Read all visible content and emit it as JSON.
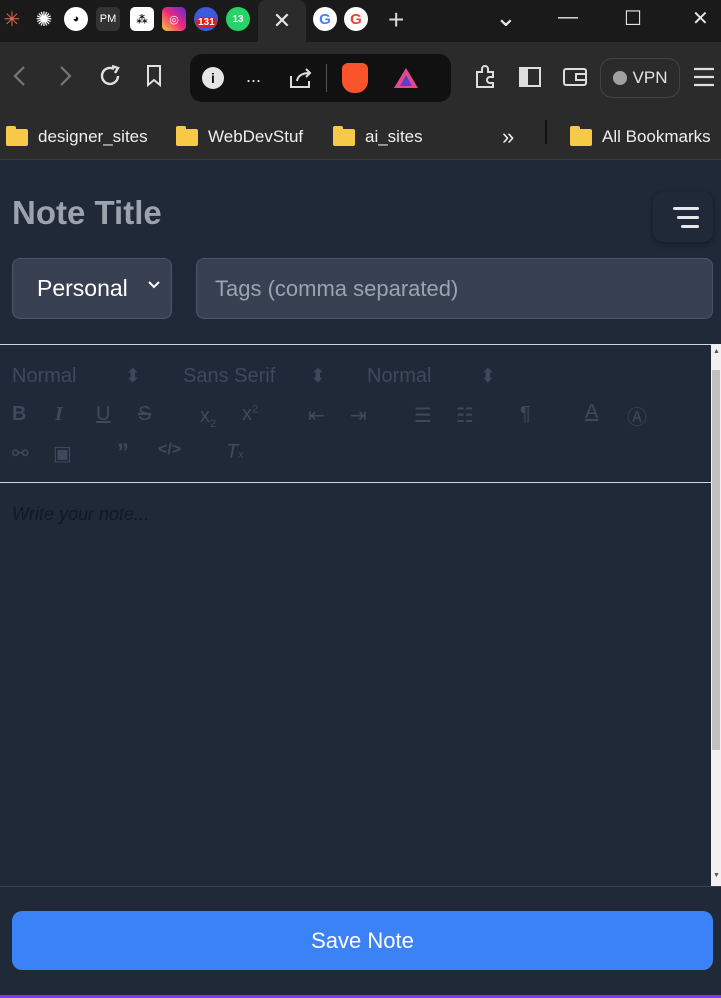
{
  "browser": {
    "tabs": {
      "pm_label": "PM",
      "badge_131": "131",
      "badge_13": "13",
      "google_1": "G",
      "google_2": "G",
      "active_close": "✕",
      "new_tab": "+"
    },
    "window": {
      "chevron": "⌄",
      "minimize": "—",
      "maximize": "☐",
      "close": "✕"
    },
    "toolbar": {
      "address_ellipsis": "...",
      "vpn_label": "VPN"
    },
    "bookmarks": [
      {
        "label": "designer_sites"
      },
      {
        "label": "WebDevStuf"
      },
      {
        "label": "ai_sites"
      }
    ],
    "bookmarks_overflow": "»",
    "all_bookmarks": "All Bookmarks"
  },
  "note": {
    "title": "Note Title",
    "category": "Personal",
    "tags_placeholder": "Tags (comma separated)",
    "editor_toolbar": {
      "header_select": "Normal",
      "font_select": "Sans Serif",
      "size_select": "Normal"
    },
    "body_placeholder": "Write your note...",
    "save_label": "Save Note"
  },
  "colors": {
    "page_bg": "#1f2937",
    "input_bg": "#374151",
    "save_button": "#3b82f6",
    "accent_line": "#7c3aed"
  }
}
